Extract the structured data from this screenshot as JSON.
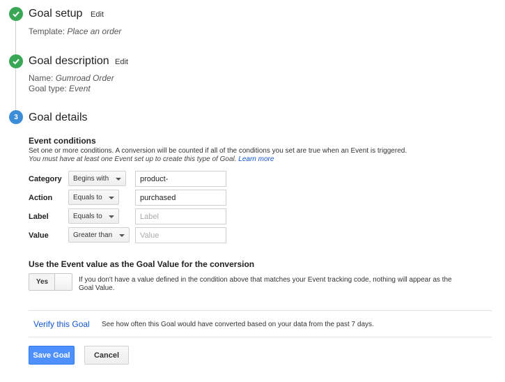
{
  "steps": {
    "setup": {
      "title": "Goal setup",
      "edit": "Edit",
      "template_label": "Template:",
      "template_value": "Place an order"
    },
    "description": {
      "title": "Goal description",
      "edit": "Edit",
      "name_label": "Name:",
      "name_value": "Gumroad Order",
      "type_label": "Goal type:",
      "type_value": "Event"
    },
    "details": {
      "number": "3",
      "title": "Goal details"
    }
  },
  "event_conditions": {
    "heading": "Event conditions",
    "desc_line1": "Set one or more conditions. A conversion will be counted if all of the conditions you set are true when an Event is triggered.",
    "desc_line2": "You must have at least one Event set up to create this type of Goal.",
    "learn_more": "Learn more",
    "rows": [
      {
        "label": "Category",
        "operator": "Begins with",
        "value": "product-",
        "placeholder": ""
      },
      {
        "label": "Action",
        "operator": "Equals to",
        "value": "purchased",
        "placeholder": ""
      },
      {
        "label": "Label",
        "operator": "Equals to",
        "value": "",
        "placeholder": "Label"
      },
      {
        "label": "Value",
        "operator": "Greater than",
        "value": "",
        "placeholder": "Value"
      }
    ]
  },
  "goal_value": {
    "heading": "Use the Event value as the Goal Value for the conversion",
    "toggle_label": "Yes",
    "toggle_on": true,
    "help_line1": "If you don't have a value defined in the condition above that matches your Event tracking code, nothing will appear as the",
    "help_line2": "Goal Value."
  },
  "verify": {
    "link": "Verify this Goal",
    "description": "See how often this Goal would have converted based on your data from the past 7 days."
  },
  "actions": {
    "save": "Save Goal",
    "cancel": "Cancel"
  },
  "colors": {
    "check_green": "#3aa757",
    "step_blue": "#3c8dd8",
    "link_blue": "#1155cc",
    "primary_button": "#4d90fe"
  }
}
